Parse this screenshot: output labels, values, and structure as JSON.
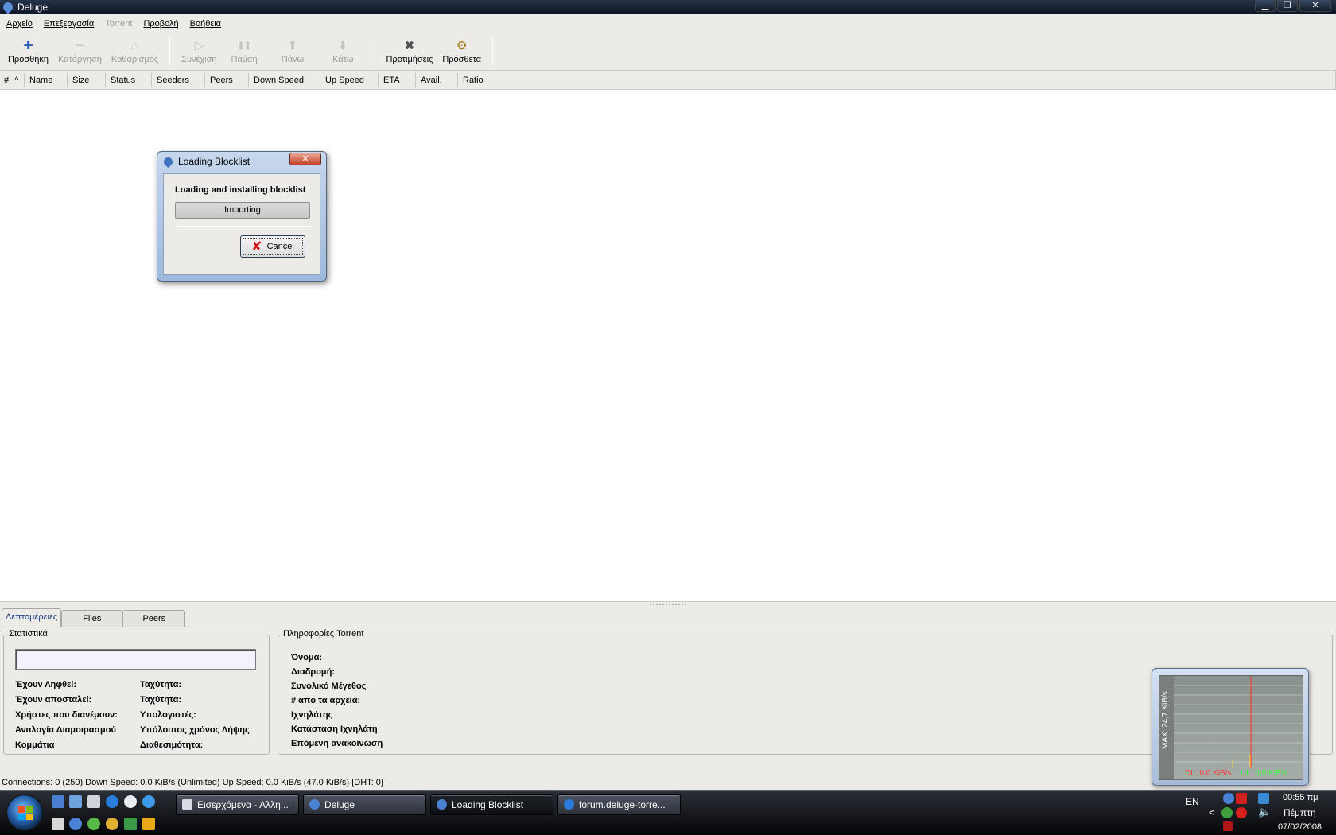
{
  "window": {
    "title": "Deluge",
    "controls": {
      "minimize": "▁",
      "restore": "❐",
      "close": "✕"
    }
  },
  "menu": {
    "items": [
      {
        "label": "Αρχείο",
        "enabled": true
      },
      {
        "label": "Επεξεργασία",
        "enabled": true
      },
      {
        "label": "Torrent",
        "enabled": false
      },
      {
        "label": "Προβολή",
        "enabled": true
      },
      {
        "label": "Βοήθεια",
        "enabled": true
      }
    ]
  },
  "toolbar": {
    "add": {
      "label": "Προσθήκη",
      "icon": "plus-icon",
      "glyph": "✚"
    },
    "remove": {
      "label": "Κατάργηση",
      "icon": "minus-icon",
      "glyph": "━"
    },
    "clear": {
      "label": "Καθαρισμός",
      "icon": "broom-icon",
      "glyph": "⌂"
    },
    "resume": {
      "label": "Συνέχιση",
      "icon": "play-icon",
      "glyph": "▷"
    },
    "pause": {
      "label": "Παύση",
      "icon": "pause-icon",
      "glyph": "❚❚"
    },
    "up": {
      "label": "Πάνω",
      "icon": "arrow-up-icon",
      "glyph": "⬆"
    },
    "down": {
      "label": "Κάτω",
      "icon": "arrow-down-icon",
      "glyph": "⬇"
    },
    "preferences": {
      "label": "Προτιμήσεις",
      "icon": "tools-icon",
      "glyph": "✖"
    },
    "plugins": {
      "label": "Πρόσθετα",
      "icon": "plugin-icon",
      "glyph": "⚙"
    }
  },
  "columns": [
    {
      "label": "#",
      "sort": "ascending"
    },
    {
      "label": "Name"
    },
    {
      "label": "Size"
    },
    {
      "label": "Status"
    },
    {
      "label": "Seeders"
    },
    {
      "label": "Peers"
    },
    {
      "label": "Down Speed"
    },
    {
      "label": "Up Speed"
    },
    {
      "label": "ETA"
    },
    {
      "label": "Avail."
    },
    {
      "label": "Ratio"
    }
  ],
  "sort_indicator": "^",
  "dialog": {
    "title": "Loading Blocklist",
    "close_label": "✕",
    "heading": "Loading and installing blocklist",
    "progress_text": "Importing",
    "progress_fraction": 1.0,
    "cancel_label": "Cancel"
  },
  "details": {
    "tabs": [
      "Λεπτομέρειες",
      "Files",
      "Peers"
    ],
    "active_tab": 0,
    "statistics": {
      "title": "Στατιστικά",
      "left_labels": [
        "Έχουν Ληφθεί:",
        "Έχουν αποσταλεί:",
        "Χρήστες που διανέμουν:",
        "Αναλογία Διαμοιρασμού",
        "Κομμάτια"
      ],
      "right_labels": [
        "Ταχύτητα:",
        "Ταχύτητα:",
        "Υπολογιστές:",
        "Υπόλοιπος χρόνος Λήψης",
        "Διαθεσιμότητα:"
      ]
    },
    "torrent_info": {
      "title": "Πληροφορίες Torrent",
      "labels": [
        "Όνομα:",
        "Διαδρομή:",
        "Συνολικό Μέγεθος",
        "# από τα αρχεία:",
        "Ιχνηλάτης",
        "Κατάσταση Ιχνηλάτη",
        "Επόμενη ανακοίνωση"
      ]
    }
  },
  "status_bar": {
    "text": "Connections: 0 (250)  Down Speed: 0.0 KiB/s (Unlimited)  Up Speed: 0.0 KiB/s (47.0 KiB/s)   [DHT: 0]"
  },
  "speed_widget": {
    "max_label": "MAX: 24,7 KiB/s",
    "dl_label": "DL: 0,0 KiB/s",
    "ul_label": "UL: 0,0 KiB/s",
    "colors": {
      "dl": "#ff3a3a",
      "ul": "#3cff3c"
    }
  },
  "taskbar": {
    "tasks": [
      {
        "label": "Εισερχόμενα - Αλλη...",
        "icon": "mail-icon",
        "active": false
      },
      {
        "label": "Deluge",
        "icon": "deluge-icon",
        "active": false
      },
      {
        "label": "Loading Blocklist",
        "icon": "deluge-icon",
        "active": true
      },
      {
        "label": "forum.deluge-torre...",
        "icon": "ie-icon",
        "active": false
      }
    ],
    "language": "EN",
    "tray_arrow": "<",
    "time": "00:55 πμ",
    "day": "Πέμπτη",
    "date": "07/02/2008"
  }
}
